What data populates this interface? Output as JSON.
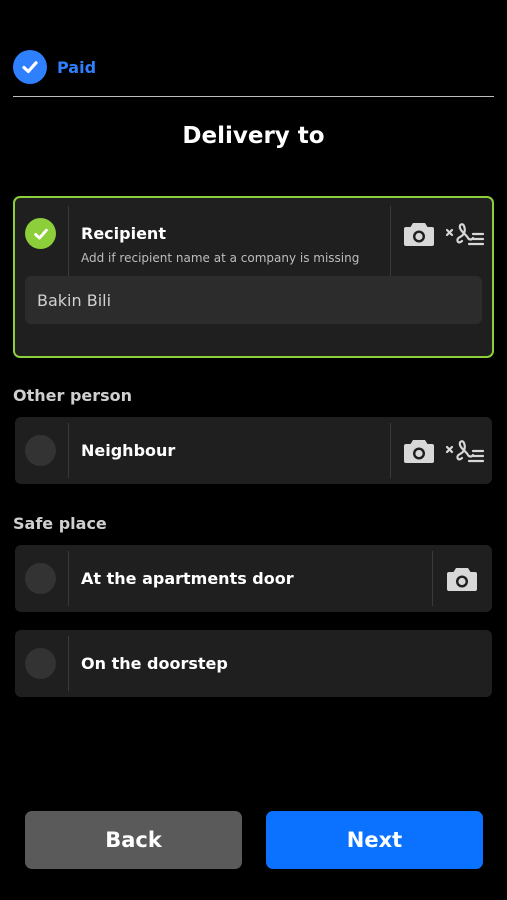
{
  "header": {
    "status_label": "Paid",
    "title": "Delivery to"
  },
  "recipient_card": {
    "title": "Recipient",
    "subtitle": "Add if recipient name at a company is missing",
    "name_value": "Bakin Bili",
    "selected": true
  },
  "sections": {
    "other_person": "Other person",
    "safe_place": "Safe place"
  },
  "options": {
    "neighbour": "Neighbour",
    "apartments_door": "At the apartments door",
    "doorstep": "On the doorstep"
  },
  "icons": {
    "camera": "camera-icon",
    "signature": "signature-icon",
    "check": "check-icon"
  },
  "colors": {
    "accent_blue": "#0a72ff",
    "paid_blue": "#2f80ff",
    "selected_green": "#8ccf3a",
    "card_bg": "#1f1f1f"
  },
  "buttons": {
    "back": "Back",
    "next": "Next"
  }
}
